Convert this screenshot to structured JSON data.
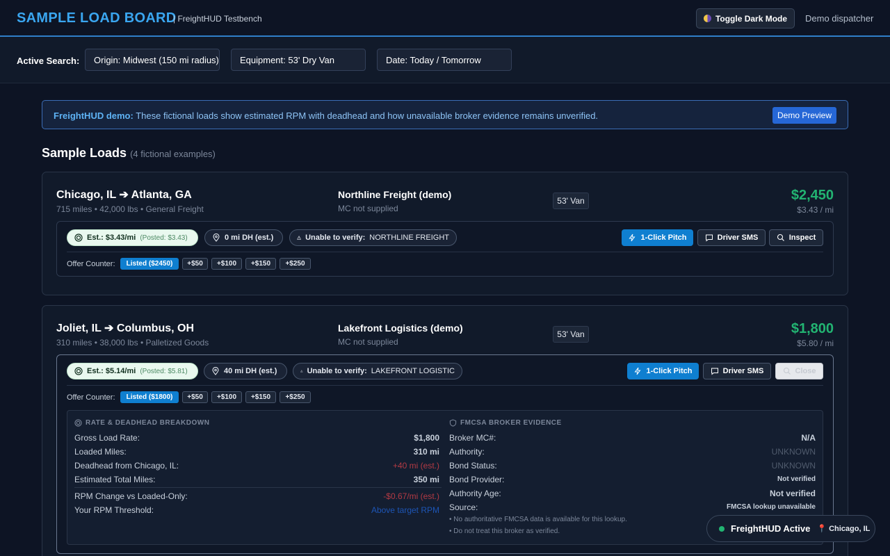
{
  "header": {
    "title": "SAMPLE LOAD BOARD",
    "subtitle": "| FreightHUD Testbench",
    "toggle_label": "Toggle Dark Mode",
    "user": "Demo dispatcher"
  },
  "search": {
    "label": "Active Search:",
    "origin": "Origin: Midwest (150 mi radius)",
    "equipment": "Equipment: 53' Dry Van",
    "date": "Date: Today / Tomorrow"
  },
  "banner": {
    "bold": "FreightHUD demo:",
    "text": " These fictional loads show estimated RPM with deadhead and how unavailable broker evidence remains unverified.",
    "button": "Demo Preview"
  },
  "section": {
    "title": "Sample Loads",
    "count": "(4 fictional examples)"
  },
  "loads": [
    {
      "route": "Chicago, IL ➔ Atlanta, GA",
      "meta": "715 miles • 42,000 lbs • General Freight",
      "broker": "Northline Freight (demo)",
      "mc": "MC not supplied",
      "equipment": "53' Van",
      "price": "$2,450",
      "rpm": "$3.43 / mi",
      "est": "Est.: $3.43/mi",
      "posted": "(Posted: $3.43)",
      "dh": "0 mi DH (est.)",
      "verify_label": "Unable to verify:",
      "verify_name": "NORTHLINE FREIGHT",
      "pitch": "1-Click Pitch",
      "sms": "Driver SMS",
      "inspect": "Inspect",
      "counter_label": "Offer Counter:",
      "counter": [
        "Listed ($2450)",
        "+$50",
        "+$100",
        "+$150",
        "+$250"
      ]
    },
    {
      "route": "Joliet, IL ➔ Columbus, OH",
      "meta": "310 miles • 38,000 lbs • Palletized Goods",
      "broker": "Lakefront Logistics (demo)",
      "mc": "MC not supplied",
      "equipment": "53' Van",
      "price": "$1,800",
      "rpm": "$5.80 / mi",
      "est": "Est.: $5.14/mi",
      "posted": "(Posted: $5.81)",
      "dh": "40 mi DH (est.)",
      "verify_label": "Unable to verify:",
      "verify_name": "LAKEFRONT LOGISTIC",
      "pitch": "1-Click Pitch",
      "sms": "Driver SMS",
      "inspect": "Close",
      "counter_label": "Offer Counter:",
      "counter": [
        "Listed ($1800)",
        "+$50",
        "+$100",
        "+$150",
        "+$250"
      ],
      "breakdown": {
        "rate_head": "RATE & DEADHEAD BREAKDOWN",
        "rate_rows": [
          {
            "label": "Gross Load Rate:",
            "value": "$1,800"
          },
          {
            "label": "Loaded Miles:",
            "value": "310 mi"
          },
          {
            "label": "Deadhead from Chicago, IL:",
            "value": "+40 mi (est.)"
          },
          {
            "label": "Estimated Total Miles:",
            "value": "350 mi"
          },
          {
            "label": "RPM Change vs Loaded-Only:",
            "value": "-$0.67/mi (est.)"
          },
          {
            "label": "Your RPM Threshold:",
            "value": "Above target RPM"
          }
        ],
        "fmcsa_head": "FMCSA BROKER EVIDENCE",
        "fmcsa_rows": [
          {
            "label": "Broker MC#:",
            "value": "N/A"
          },
          {
            "label": "Authority:",
            "value": "UNKNOWN"
          },
          {
            "label": "Bond Status:",
            "value": "UNKNOWN"
          },
          {
            "label": "Bond Provider:",
            "value": "Not verified"
          },
          {
            "label": "Authority Age:",
            "value": "Not verified"
          },
          {
            "label": "Source:",
            "value": "FMCSA lookup unavailable"
          }
        ],
        "notes": [
          "• No authoritative FMCSA data is available for this lookup.",
          "• Do not treat this broker as verified."
        ]
      }
    }
  ],
  "status": {
    "title": "FreightHUD Active",
    "location": "Chicago, IL"
  }
}
